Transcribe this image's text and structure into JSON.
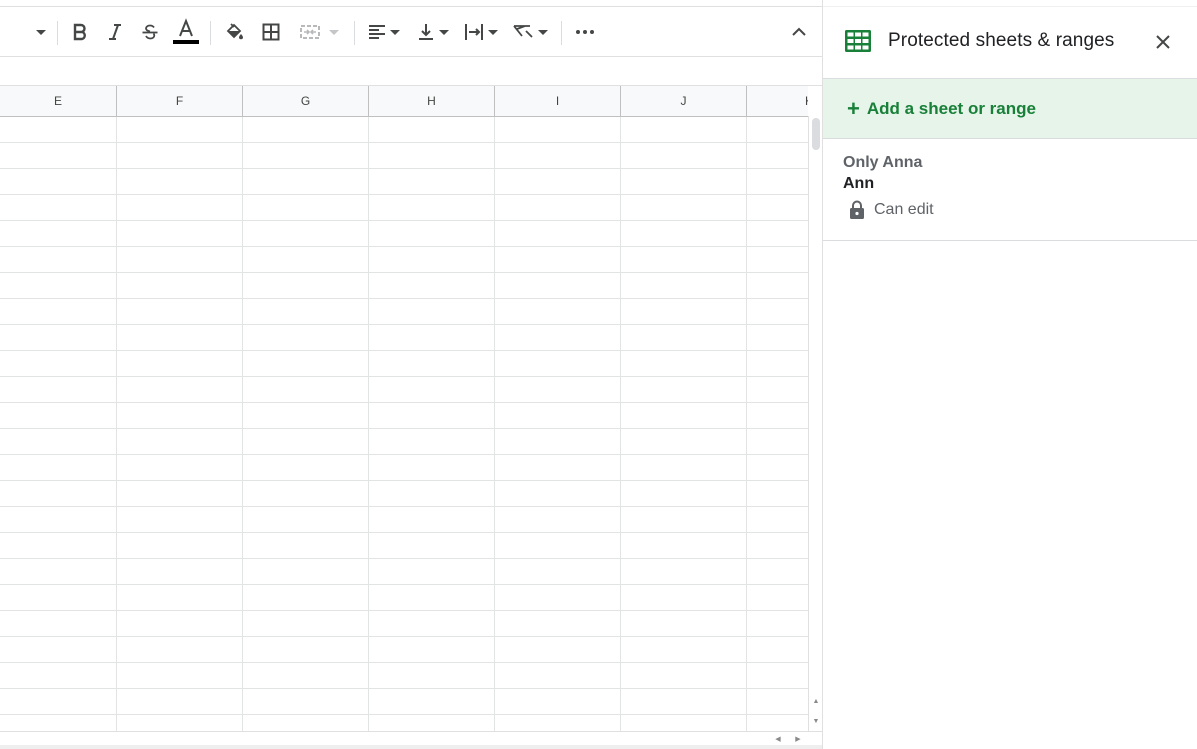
{
  "toolbar": {
    "buttons": [
      {
        "name": "font-size-dropdown",
        "icon": "chevron-down-icon"
      },
      {
        "name": "bold-button",
        "icon": "bold-icon"
      },
      {
        "name": "italic-button",
        "icon": "italic-icon"
      },
      {
        "name": "strikethrough-button",
        "icon": "strikethrough-icon"
      },
      {
        "name": "text-color-button",
        "icon": "text-color-icon"
      },
      {
        "name": "fill-color-button",
        "icon": "paint-bucket-icon"
      },
      {
        "name": "borders-button",
        "icon": "borders-icon"
      },
      {
        "name": "merge-cells-button",
        "icon": "merge-icon",
        "disabled": true
      },
      {
        "name": "horizontal-align-button",
        "icon": "align-left-icon"
      },
      {
        "name": "vertical-align-button",
        "icon": "align-bottom-icon"
      },
      {
        "name": "text-wrapping-button",
        "icon": "wrap-icon"
      },
      {
        "name": "text-rotation-button",
        "icon": "rotate-icon"
      },
      {
        "name": "more-button",
        "icon": "more-icon"
      },
      {
        "name": "collapse-toolbar-button",
        "icon": "chevron-up-icon"
      }
    ],
    "text_color_swatch": "#000000"
  },
  "grid": {
    "columns": [
      "E",
      "F",
      "G",
      "H",
      "I",
      "J",
      "K"
    ],
    "visible_rows": 24
  },
  "panel": {
    "title": "Protected sheets & ranges",
    "add_label": "Add a sheet or range",
    "add_plus": "+",
    "items": [
      {
        "description": "Only Anna",
        "range": "Ann",
        "permission": "Can edit"
      }
    ]
  },
  "colors": {
    "accent_green": "#188038",
    "add_row_bg": "#e6f4ea",
    "sheets_icon": "#188038"
  }
}
